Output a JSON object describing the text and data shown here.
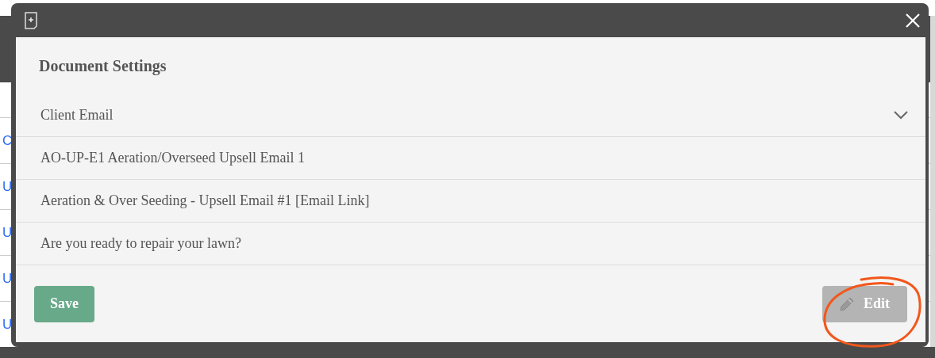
{
  "background_page": {
    "links": [
      "C",
      "U",
      "U",
      "U",
      "U"
    ]
  },
  "dialog": {
    "title": "Document Settings",
    "fields": [
      {
        "kind": "select",
        "value": "Client Email"
      },
      {
        "kind": "text",
        "value": "AO-UP-E1 Aeration/Overseed Upsell Email 1"
      },
      {
        "kind": "text",
        "value": "Aeration & Over Seeding - Upsell Email #1 [Email Link]"
      },
      {
        "kind": "text",
        "value": "Are you ready to repair your lawn?"
      }
    ],
    "buttons": [
      {
        "kind": "primary",
        "label": "Save",
        "disabled": false
      },
      {
        "kind": "edit",
        "label": "Edit",
        "disabled": true
      }
    ]
  }
}
